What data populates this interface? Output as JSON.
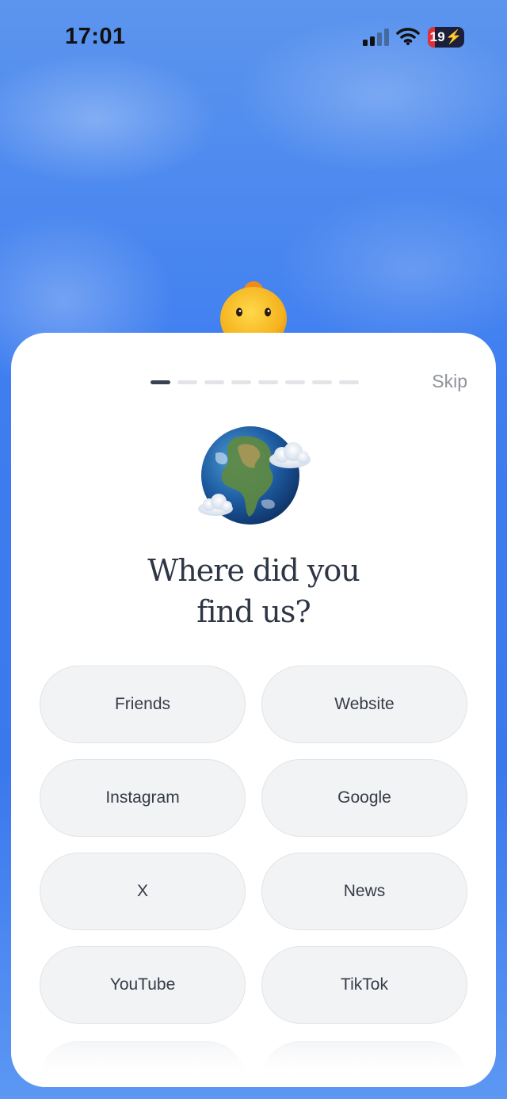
{
  "status_bar": {
    "time": "17:01",
    "battery": "19",
    "battery_level_percent": 19,
    "icons": [
      "signal-icon",
      "wifi-icon",
      "battery-charging-icon"
    ]
  },
  "mascot": {
    "icon": "duck-icon"
  },
  "onboarding": {
    "progress": {
      "total_steps": 8,
      "current_step": 1
    },
    "skip_label": "Skip",
    "hero_icon": "globe-with-clouds-icon",
    "title": "Where did you\nfind us?",
    "options": [
      {
        "label": "Friends"
      },
      {
        "label": "Website"
      },
      {
        "label": "Instagram"
      },
      {
        "label": "Google"
      },
      {
        "label": "X"
      },
      {
        "label": "News"
      },
      {
        "label": "YouTube"
      },
      {
        "label": "TikTok"
      }
    ]
  },
  "colors": {
    "background_blue": "#3e7ef0",
    "sheet": "#ffffff",
    "title_text": "#2e3645",
    "option_bg": "#f2f3f5",
    "progress_active": "#3a4150",
    "progress_inactive": "#e3e4e8",
    "battery_low": "#e0303a"
  }
}
